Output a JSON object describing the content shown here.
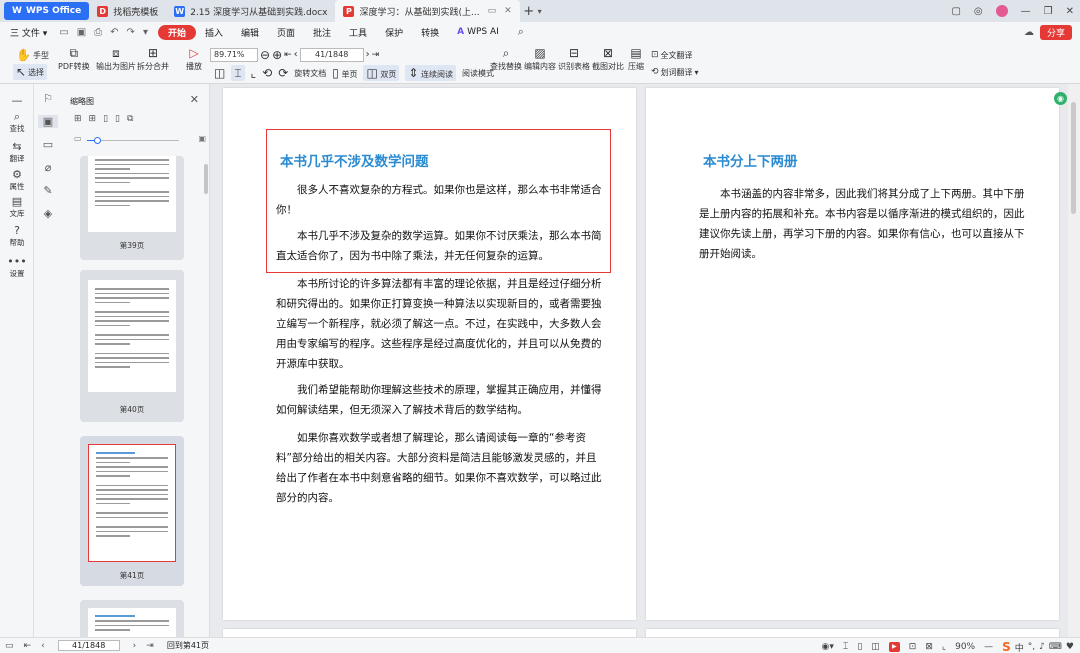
{
  "titlebar": {
    "app": "WPS Office",
    "tabs": [
      {
        "label": "找稻壳模板",
        "color": "#e53935"
      },
      {
        "label": "2.15 深度学习从基础到实践.docx",
        "color": "#2b6ff5"
      },
      {
        "label": "深度学习：从基础到实践(上...",
        "color": "#e53935"
      }
    ]
  },
  "menubar": {
    "file": "三 文件 ▾",
    "items": [
      "开始",
      "插入",
      "编辑",
      "页面",
      "批注",
      "工具",
      "保护",
      "转换"
    ],
    "wps_ai": "WPS AI",
    "share": "分享"
  },
  "ribbon": {
    "hand": "手型",
    "select": "选择",
    "pdf_convert": "PDF转换",
    "export_image": "输出为图片",
    "split_merge": "拆分合并",
    "play": "播放",
    "zoom": "89.71%",
    "page_input": "41/1848",
    "rotate": "旋转文档",
    "single": "单页",
    "double": "双页",
    "continuous": "连续阅读",
    "read_mode": "阅读模式",
    "find_replace": "查找替换",
    "edit_content": "编辑内容",
    "recognize_table": "识别表格",
    "compare_shot": "截图对比",
    "compress": "压缩",
    "full_translate": "全文翻译",
    "word_translate": "划词翻译"
  },
  "rail": [
    "查找",
    "翻译",
    "属性",
    "文库",
    "帮助",
    "设置"
  ],
  "panel": {
    "title": "缩略图",
    "thumbs": [
      "第39页",
      "第40页",
      "第41页"
    ]
  },
  "page1": {
    "heading": "本书几乎不涉及数学问题",
    "paragraphs": [
      "很多人不喜欢复杂的方程式。如果你也是这样，那么本书非常适合你！",
      "本书几乎不涉及复杂的数学运算。如果你不讨厌乘法，那么本书简直太适合你了，因为书中除了乘法，并无任何复杂的运算。",
      "本书所讨论的许多算法都有丰富的理论依据，并且是经过仔细分析和研究得出的。如果你正打算变换一种算法以实现新目的，或者需要独立编写一个新程序，就必须了解这一点。不过，在实践中，大多数人会用由专家编写的程序。这些程序是经过高度优化的，并且可以从免费的开源库中获取。",
      "我们希望能帮助你理解这些技术的原理，掌握其正确应用，并懂得如何解读结果，但无须深入了解技术背后的数学结构。",
      "如果你喜欢数学或者想了解理论，那么请阅读每一章的“参考资料”部分给出的相关内容。大部分资料是简洁且能够激发灵感的，并且给出了作者在本书中刻意省略的细节。如果你不喜欢数学，可以略过此部分的内容。"
    ]
  },
  "page2": {
    "heading": "本书分上下两册",
    "paragraphs": [
      "本书涵盖的内容非常多，因此我们将其分成了上下两册。其中下册是上册内容的拓展和补充。本书内容是以循序渐进的模式组织的，因此建议你先读上册，再学习下册的内容。如果你有信心，也可以直接从下册开始阅读。"
    ]
  },
  "status": {
    "page": "41/1848",
    "back": "回到第41页",
    "zoom": "90%"
  }
}
